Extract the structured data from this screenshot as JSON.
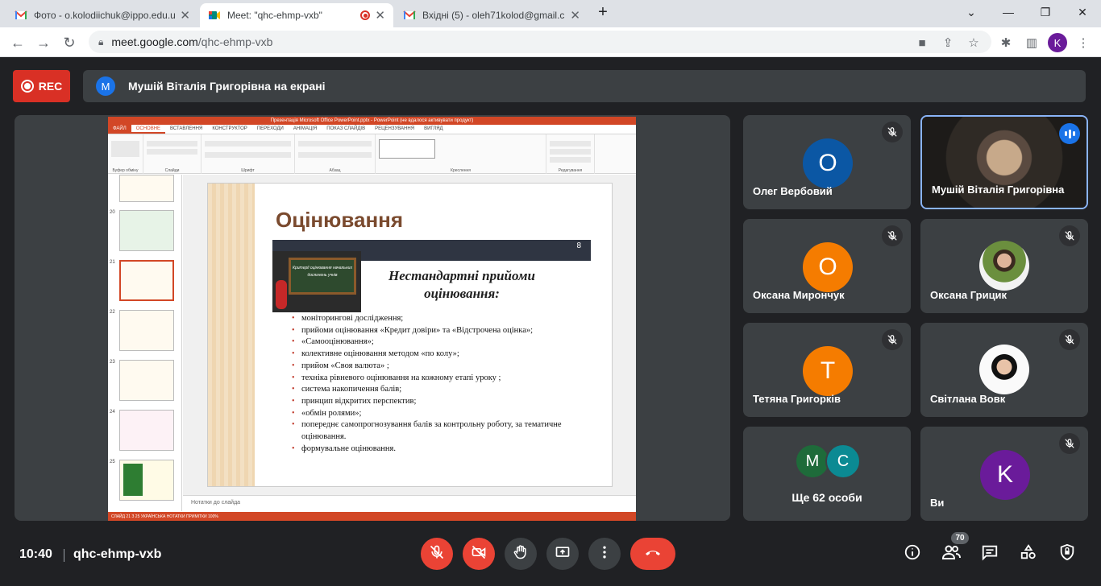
{
  "browser": {
    "tabs": [
      {
        "title": "Фото - o.kolodiichuk@ippo.edu.u",
        "active": false
      },
      {
        "title": "Meet: \"qhc-ehmp-vxb\"",
        "active": true
      },
      {
        "title": "Вхідні (5) - oleh71kolod@gmail.c",
        "active": false
      }
    ],
    "url_host": "meet.google.com",
    "url_path": "/qhc-ehmp-vxb",
    "profile_initial": "K"
  },
  "meet": {
    "rec_label": "REC",
    "presenter_initial": "M",
    "presenting_text": "Мушій Віталія Григорівна на екрані",
    "time": "10:40",
    "meeting_code": "qhc-ehmp-vxb",
    "participants_count": "70"
  },
  "presentation": {
    "window_title": "Презентація Microsoft Office PowerPoint.pptx - PowerPoint (не вдалося активувати продукт)",
    "ribbon_tabs": [
      "ФАЙЛ",
      "ОСНОВНЕ",
      "ВСТАВЛЕННЯ",
      "КОНСТРУКТОР",
      "ПЕРЕХОДИ",
      "АНІМАЦІЯ",
      "ПОКАЗ СЛАЙДІВ",
      "РЕЦЕНЗУВАННЯ",
      "ВИГЛЯД"
    ],
    "ribbon_groups": [
      "Буфер обміну",
      "Слайди",
      "Шрифт",
      "Абзац",
      "Креслення",
      "Редагування"
    ],
    "thumb_numbers": [
      "20",
      "21",
      "22",
      "23",
      "24",
      "25"
    ],
    "slide_title": "Оцінювання",
    "slide_number": "8",
    "board_text": "Критерії оцінювання начальних досягнень учнів",
    "subtitle": "Нестандартні прийоми оцінювання:",
    "bullets": [
      "моніторингові дослідження;",
      "прийоми оцінювання «Кредит довіри» та «Відстрочена оцінка»;",
      " «Самооцінювання»;",
      "колективне оцінювання методом «по колу»;",
      "прийом «Своя валюта» ;",
      "техніка рівневого оцінювання на кожному етапі уроку ;",
      "система накопичення балів;",
      "принцип відкритих перспектив;",
      "«обмін ролями»;",
      "попереднє самопрогнозування балів за контрольну роботу, за тематичне оцінювання.",
      "формувальне оцінювання."
    ],
    "notes_placeholder": "Нотатки до слайда",
    "status": "СЛАЙД 21 З 25    УКРАЇНСЬКА                                                                                                 НОТАТКИ    ПРИМІТКИ                                 100%"
  },
  "participants": [
    {
      "name": "Олег Вербовий",
      "initial": "O",
      "color": "#0b57a4",
      "muted": true
    },
    {
      "name": "Мушій Віталія Григорівна",
      "camera": true,
      "speaking": true
    },
    {
      "name": "Оксана Мирончук",
      "initial": "O",
      "color": "#f57c00",
      "muted": true
    },
    {
      "name": "Оксана Грицик",
      "photo": true,
      "muted": true
    },
    {
      "name": "Тетяна Григорків",
      "initial": "T",
      "color": "#f57c00",
      "muted": true
    },
    {
      "name": "Світлана Вовк",
      "photo": true,
      "muted": true
    },
    {
      "name": "Ще 62 особи",
      "initials": [
        "M",
        "C"
      ],
      "colors": [
        "#1e6b3a",
        "#0b8a93"
      ]
    },
    {
      "name": "Ви",
      "initial": "K",
      "color": "#6a1b9a",
      "muted": true
    }
  ],
  "icons": {
    "mic": "mic-off-icon",
    "cam": "videocam-off-icon",
    "hand": "raise-hand-icon",
    "present": "present-screen-icon",
    "more": "more-vert-icon",
    "end": "call-end-icon",
    "info": "info-icon",
    "people": "people-icon",
    "chat": "chat-icon",
    "activities": "activities-icon",
    "host": "host-controls-icon"
  }
}
